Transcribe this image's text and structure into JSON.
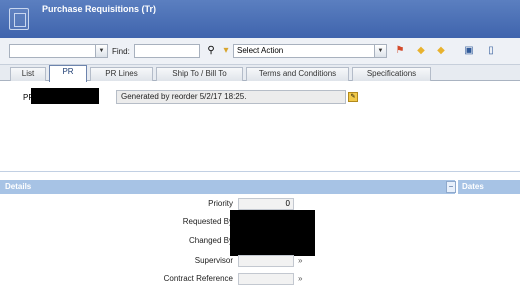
{
  "window": {
    "title": "Purchase Requisitions (Tr)"
  },
  "toolbar": {
    "find_label": "Find:",
    "action_select": "Select Action"
  },
  "tabs": [
    "List",
    "PR",
    "PR Lines",
    "Ship To / Bill To",
    "Terms and Conditions",
    "Specifications"
  ],
  "header": {
    "pr_label": "PR",
    "description": "Generated by reorder 5/2/17 18:25."
  },
  "details": {
    "title": "Details",
    "dates_title": "Dates",
    "priority_label": "Priority",
    "priority_value": "0",
    "requested_by_label": "Requested By",
    "changed_by_label": "Changed By",
    "supervisor_label": "Supervisor",
    "contract_label": "Contract Reference"
  },
  "icons": {
    "app": "document-icon",
    "binoculars": "binoculars-icon",
    "filter": "filter-icon",
    "action": "action-icon",
    "prev": "previous-icon",
    "next": "next-icon",
    "save": "save-icon",
    "copy": "copy-icon",
    "note": "note-icon"
  }
}
